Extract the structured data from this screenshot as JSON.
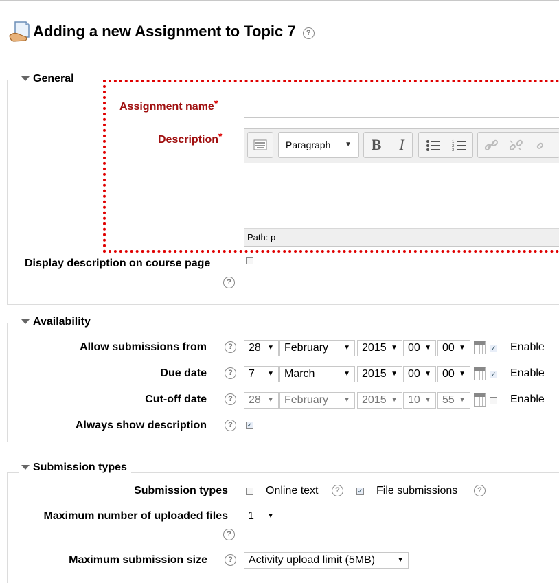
{
  "page": {
    "title": "Adding a new Assignment to Topic 7"
  },
  "icons": {
    "help": "?",
    "page_icon": "assignment-icon"
  },
  "general": {
    "legend": "General",
    "assignment_name_label": "Assignment name",
    "description_label": "Description",
    "required_mark": "*",
    "editor": {
      "format_select": "Paragraph",
      "bold": "B",
      "italic": "I",
      "path": "Path: p"
    },
    "display_description_label": "Display description on course page"
  },
  "availability": {
    "legend": "Availability",
    "rows": [
      {
        "label": "Allow submissions from",
        "day": "28",
        "month": "February",
        "year": "2015",
        "hour": "00",
        "minute": "00",
        "enabled": true,
        "enable_label": "Enable"
      },
      {
        "label": "Due date",
        "day": "7",
        "month": "March",
        "year": "2015",
        "hour": "00",
        "minute": "00",
        "enabled": true,
        "enable_label": "Enable"
      },
      {
        "label": "Cut-off date",
        "day": "28",
        "month": "February",
        "year": "2015",
        "hour": "10",
        "minute": "55",
        "enabled": false,
        "enable_label": "Enable"
      }
    ],
    "always_show_label": "Always show description",
    "always_show_checked": true
  },
  "submission": {
    "legend": "Submission types",
    "types_label": "Submission types",
    "online_text": "Online text",
    "online_text_checked": false,
    "file_submissions": "File submissions",
    "file_submissions_checked": true,
    "max_files_label": "Maximum number of uploaded files",
    "max_files_value": "1",
    "max_size_label": "Maximum submission size",
    "max_size_value": "Activity upload limit (5MB)"
  },
  "colors": {
    "required": "#a01010",
    "highlight": "#e00000"
  }
}
